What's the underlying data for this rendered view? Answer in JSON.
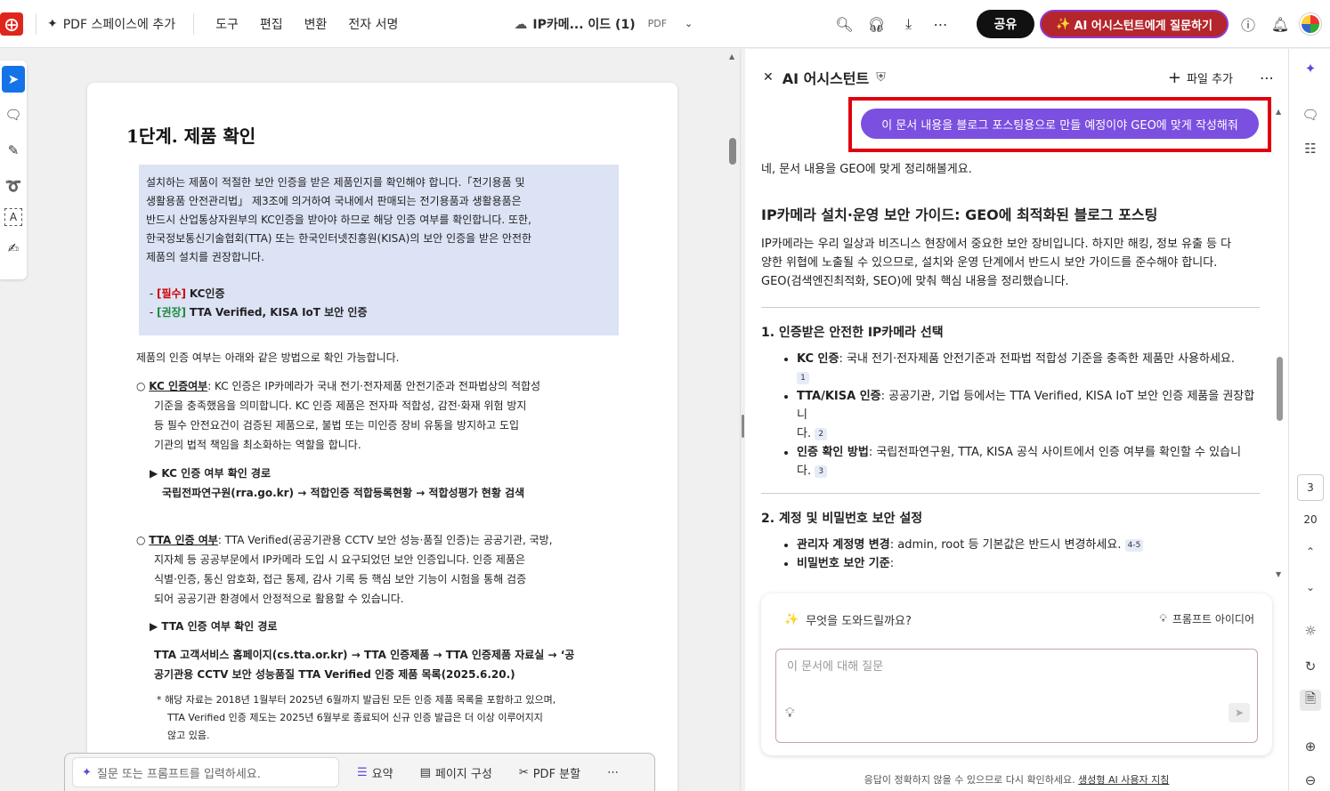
{
  "topbar": {
    "app_logo": "acrobat-logo",
    "add_to_space": "PDF 스페이스에 추가",
    "menu": [
      "도구",
      "편집",
      "변환",
      "전자 서명"
    ],
    "doc_title": "IP카메... 이드 (1)",
    "doc_type": "PDF",
    "share": "공유",
    "ai_ask": "AI 어시스턴트에게 질문하기"
  },
  "document": {
    "heading": "1단계. 제품 확인",
    "box_lines": [
      "설치하는 제품이 적절한 보안 인증을 받은 제품인지를 확인해야 합니다.「전기용품 및",
      "생활용품 안전관리법」 제3조에 의거하여 국내에서 판매되는 전기용품과 생활용품은",
      "반드시 산업통상자원부의 KC인증을 받아야 하므로 해당 인증 여부를 확인합니다. 또한,",
      "한국정보통신기술협회(TTA) 또는 한국인터넷진흥원(KISA)의 보안 인증을 받은 안전한",
      "제품의 설치를 권장합니다."
    ],
    "req_tag": "[필수]",
    "req_text": "KC인증",
    "rec_tag": "[권장]",
    "rec_text": "TTA Verified, KISA IoT 보안 인증",
    "intro": "제품의 인증 여부는 아래와 같은 방법으로 확인 가능합니다.",
    "kc_title": "KC 인증여부",
    "kc_lines": [
      ": KC 인증은 IP카메라가 국내 전기·전자제품 안전기준과 전파법상의 적합성",
      "기준을 충족했음을 의미합니다. KC 인증 제품은 전자파 적합성, 감전·화재 위험 방지",
      "등 필수 안전요건이 검증된 제품으로, 불법 또는 미인증 장비 유통을 방지하고 도입",
      "기관의 법적 책임을 최소화하는 역할을 합니다."
    ],
    "kc_path_title": "KC 인증 여부 확인 경로",
    "kc_path": "국립전파연구원(rra.go.kr) → 적합인증 적합등록현황 → 적합성평가 현황 검색",
    "tta_title": "TTA 인증 여부",
    "tta_lines": [
      ": TTA Verified(공공기관용 CCTV 보안 성능·품질 인증)는 공공기관, 국방,",
      "지자체 등 공공부문에서 IP카메라 도입 시 요구되었던 보안 인증입니다. 인증 제품은",
      "식별·인증, 통신 암호화, 접근 통제, 감사 기록 등 핵심 보안 기능이 시험을 통해 검증",
      "되어 공공기관 환경에서 안정적으로 활용할 수 있습니다."
    ],
    "tta_path_title": "TTA 인증 여부 확인 경로",
    "tta_path_1": "TTA 고객서비스 홈페이지(cs.tta.or.kr) → TTA 인증제품 → TTA 인증제품 자료실 → ‘공",
    "tta_path_2": "공기관용 CCTV 보안 성능품질 TTA Verified 인증 제품 목록(2025.6.20.)",
    "note_1": "* 해당 자료는 2018년 1월부터 2025년 6월까지 발급된 모든 인증 제품 목록을 포함하고 있으며,",
    "note_2": "TTA Verified 인증 제도는 2025년 6월부로 종료되어 신규 인증 발급은 더 이상 이루어지지",
    "note_3": "않고 있음."
  },
  "bottom_bar": {
    "placeholder": "질문 또는 프롬프트를 입력하세요.",
    "summary": "요약",
    "page_layout": "페이지 구성",
    "pdf_split": "PDF 분할"
  },
  "ai_panel": {
    "title": "AI 어시스턴트",
    "add_file": "파일 추가",
    "user_message": "이 문서 내용을 블로그 포스팅용으로 만들 예정이야 GEO에 맞게 작성해줘",
    "reply_intro": "네, 문서 내용을 GEO에 맞게 정리해볼게요.",
    "h2": "IP카메라 설치·운영 보안 가이드: GEO에 최적화된 블로그 포스팅",
    "para_lines": [
      "IP카메라는 우리 일상과 비즈니스 현장에서 중요한 보안 장비입니다. 하지만 해킹, 정보 유출 등 다",
      "양한 위협에 노출될 수 있으므로, 설치와 운영 단계에서 반드시 보안 가이드를 준수해야 합니다.",
      "GEO(검색엔진최적화, SEO)에 맞춰 핵심 내용을 정리했습니다."
    ],
    "s1_title": "1. 인증받은 안전한 IP카메라 선택",
    "s1_items": [
      {
        "label": "KC 인증",
        "text": ": 국내 전기·전자제품 안전기준과 전파법 적합성 기준을 충족한 제품만 사용하세요.",
        "cite": "1"
      },
      {
        "label": "TTA/KISA 인증",
        "text": ": 공공기관, 기업 등에서는 TTA Verified, KISA IoT 보안 인증 제품을 권장합니",
        "text2": "다.",
        "cite": "2"
      },
      {
        "label": "인증 확인 방법",
        "text": ": 국립전파연구원, TTA, KISA 공식 사이트에서 인증 여부를 확인할 수 있습니",
        "text2": "다.",
        "cite": "3"
      }
    ],
    "s2_title": "2. 계정 및 비밀번호 보안 설정",
    "s2_items": [
      {
        "label": "관리자 계정명 변경",
        "text": ": admin, root 등 기본값은 반드시 변경하세요.",
        "cite": "4-5"
      },
      {
        "label": "비밀번호 보안 기준",
        "text": ":"
      }
    ],
    "prompt_title": "무엇을 도와드릴까요?",
    "prompt_ideas": "프롬프트 아이디어",
    "prompt_placeholder": "이 문서에 대해 질문",
    "footer": "응답이 정확하지 않을 수 있으므로 다시 확인하세요.",
    "footer_link": "생성형 AI 사용자 지침"
  },
  "right_rail": {
    "current_page": "3",
    "total_pages": "20"
  }
}
